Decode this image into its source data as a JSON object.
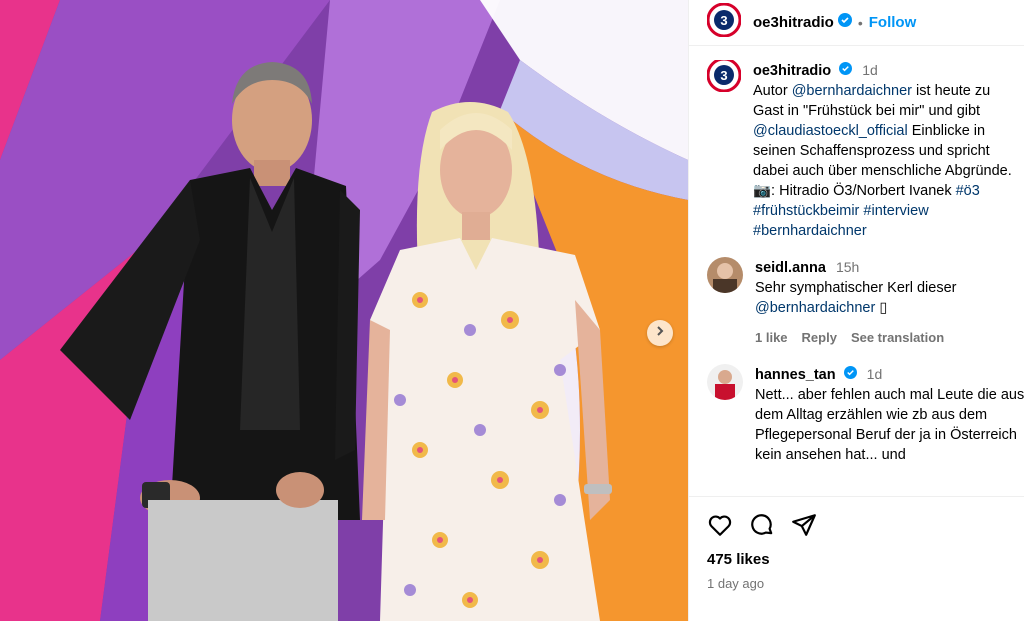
{
  "header": {
    "username": "oe3hitradio",
    "follow_label": "Follow",
    "separator": "•"
  },
  "caption": {
    "username": "oe3hitradio",
    "time": "1d",
    "parts": [
      {
        "text": "Autor ",
        "link": false
      },
      {
        "text": "@bernhardaichner",
        "link": true
      },
      {
        "text": " ist heute zu Gast in \"Frühstück bei mir\" und gibt ",
        "link": false
      },
      {
        "text": "@claudiastoeckl_official",
        "link": true
      },
      {
        "text": " Einblicke in seinen Schaffensprozess und spricht dabei auch über menschliche Abgründe. ",
        "link": false
      },
      {
        "text": "📷: Hitradio Ö3/Norbert Ivanek ",
        "link": false
      },
      {
        "text": "#ö3",
        "link": true
      },
      {
        "text": " ",
        "link": false
      },
      {
        "text": "#frühstückbeimir",
        "link": true
      },
      {
        "text": " ",
        "link": false
      },
      {
        "text": "#interview",
        "link": true
      },
      {
        "text": " ",
        "link": false
      },
      {
        "text": "#bernhardaichner",
        "link": true
      }
    ]
  },
  "comments": [
    {
      "username": "seidl.anna",
      "time": "15h",
      "text": "Sehr symphatischer Kerl dieser ",
      "mention": "@bernhardaichner",
      "emoji": "▯",
      "likes": "1 like",
      "reply": "Reply",
      "translate": "See translation",
      "verified": false
    },
    {
      "username": "hannes_tan",
      "time": "1d",
      "text": "Nett... aber fehlen auch mal Leute die aus dem Alltag erzählen wie zb aus dem Pflegepersonal Beruf der ja in Österreich kein ansehen hat... und",
      "verified": true
    }
  ],
  "stats": {
    "likes": "475 likes",
    "posted": "1 day ago"
  },
  "colors": {
    "accent": "#0095f6",
    "link": "#00376b",
    "muted": "#737373",
    "brand_red": "#d6002a",
    "verified": "#0095f6"
  },
  "icons": [
    "heart-icon",
    "comment-icon",
    "share-icon",
    "verified-badge-icon",
    "chevron-right-icon",
    "oe3-logo-icon"
  ]
}
